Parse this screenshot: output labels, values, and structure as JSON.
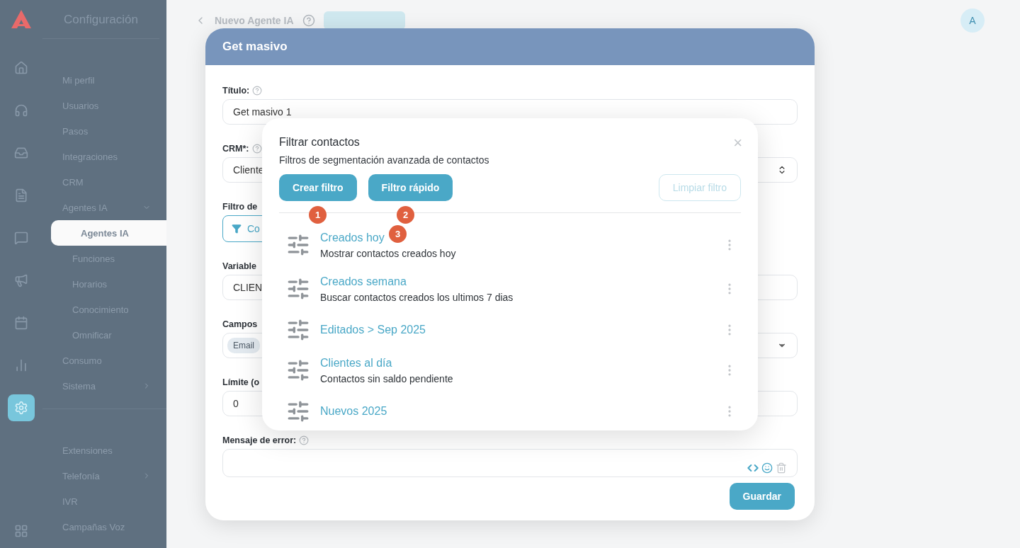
{
  "rail": [
    {
      "selected": false
    },
    {
      "selected": false
    },
    {
      "selected": false
    },
    {
      "selected": false
    },
    {
      "selected": false
    },
    {
      "selected": false
    },
    {
      "selected": false
    },
    {
      "selected": false
    },
    {
      "selected": true
    }
  ],
  "sidebar": {
    "title": "Configuración",
    "groups": [
      {
        "items": [
          {
            "kind": "link",
            "label": "Mi perfil",
            "selected": false
          },
          {
            "kind": "link",
            "label": "Usuarios",
            "selected": false
          },
          {
            "kind": "link",
            "label": "Pasos",
            "selected": false
          },
          {
            "kind": "link",
            "label": "Integraciones",
            "selected": false
          },
          {
            "kind": "link",
            "label": "CRM",
            "selected": false
          },
          {
            "kind": "group",
            "label": "Agentes IA",
            "selected": false,
            "expanded": true,
            "children": [
              {
                "kind": "link",
                "label": "Agentes IA",
                "selected": true
              },
              {
                "kind": "link",
                "label": "Funciones",
                "selected": false
              },
              {
                "kind": "link",
                "label": "Horarios",
                "selected": false
              },
              {
                "kind": "link",
                "label": "Conocimiento",
                "selected": false
              },
              {
                "kind": "link",
                "label": "Omnificar",
                "selected": false
              }
            ]
          },
          {
            "kind": "link",
            "label": "Consumo",
            "selected": false
          },
          {
            "kind": "group",
            "label": "Sistema",
            "selected": false,
            "expanded": false
          }
        ]
      },
      {
        "items": [
          {
            "kind": "link",
            "label": "Extensiones",
            "selected": false
          },
          {
            "kind": "group",
            "label": "Telefonía",
            "selected": false,
            "expanded": false
          },
          {
            "kind": "link",
            "label": "IVR",
            "selected": false
          },
          {
            "kind": "link",
            "label": "Campañas Voz",
            "selected": false
          }
        ]
      }
    ]
  },
  "header": {
    "title": "Nuevo Agente IA",
    "avatar": "A"
  },
  "modal": {
    "title": "Get masivo",
    "fields": [
      {
        "kind": "input",
        "label": "Título:",
        "help": true,
        "value": "Get masivo 1"
      },
      {
        "kind": "select",
        "label": "CRM*:",
        "help": true,
        "value": "Cliente"
      },
      {
        "kind": "button",
        "label": "Filtro de",
        "value": "Co"
      },
      {
        "kind": "input",
        "label": "Variable",
        "value": "CLIEN"
      },
      {
        "kind": "tags",
        "label": "Campos",
        "tags": [
          "Email"
        ]
      },
      {
        "kind": "input",
        "label": "Límite (o",
        "value": "0"
      },
      {
        "kind": "textarea",
        "label": "Mensaje de error:",
        "help": true
      }
    ],
    "save": "Guardar"
  },
  "filter_popup": {
    "title": "Filtrar contactos",
    "subtitle": "Filtros de segmentación avanzada de contactos",
    "close": "×",
    "buttons": [
      {
        "kind": "primary",
        "label": "Crear filtro",
        "disabled": false
      },
      {
        "kind": "primary",
        "label": "Filtro rápido",
        "disabled": false
      },
      {
        "kind": "outline",
        "label": "Limpiar filtro",
        "disabled": true
      }
    ],
    "filters": [
      {
        "title": "Creados hoy",
        "description": "Mostrar contactos creados hoy"
      },
      {
        "title": "Creados semana",
        "description": "Buscar contactos creados los ultimos 7 dias"
      },
      {
        "title": "Editados > Sep 2025"
      },
      {
        "title": "Clientes al día",
        "description": "Contactos sin saldo pendiente"
      },
      {
        "title": "Nuevos 2025"
      }
    ],
    "markers": [
      "1",
      "2",
      "3"
    ]
  }
}
